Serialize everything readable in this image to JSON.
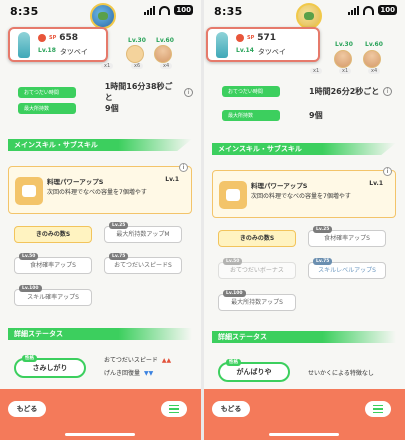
{
  "left": {
    "status": {
      "time": "8:35",
      "battery": "100"
    },
    "pokemon_card": {
      "sp_label": "SP",
      "sp_value": "658",
      "level_label": "Lv.18",
      "name": "タツベイ"
    },
    "items": [
      {
        "level_label": "Lv.30",
        "count": "x6"
      },
      {
        "level_label": "Lv.60",
        "count": "x4"
      },
      {
        "count": "x1"
      }
    ],
    "info": [
      {
        "label": "おてつだい時間",
        "value": "1時間16分38秒ごと"
      },
      {
        "label": "最大所持数",
        "value": "9個"
      }
    ],
    "section_skills": "メインスキル・サブスキル",
    "main_skill": {
      "name": "料理パワーアップS",
      "level": "Lv.1",
      "desc": "次回の料理でなべの容量を7個増やす"
    },
    "sub_skills": [
      {
        "tag": "",
        "label": "きのみの数S",
        "style": "gold"
      },
      {
        "tag": "Lv.25",
        "label": "最大所持数アップM",
        "style": "plain"
      },
      {
        "tag": "Lv.50",
        "label": "食材確率アップS",
        "style": "plain"
      },
      {
        "tag": "Lv.75",
        "label": "おてつだいスピードS",
        "style": "plain"
      },
      {
        "tag": "Lv.100",
        "label": "スキル確率アップS",
        "style": "plain"
      }
    ],
    "section_status": "詳細ステータス",
    "nature": {
      "tag": "性格",
      "name": "さみしがり"
    },
    "effects": [
      {
        "label": "おてつだいスピード",
        "mark": "▲▲",
        "dir": "up"
      },
      {
        "label": "げんき回復量",
        "mark": "▼▼",
        "dir": "down"
      }
    ],
    "back_label": "もどる"
  },
  "right": {
    "status": {
      "time": "8:35",
      "battery": "100"
    },
    "pokemon_card": {
      "sp_label": "SP",
      "sp_value": "571",
      "level_label": "Lv.14",
      "name": "タツベイ"
    },
    "items": [
      {
        "level_label": "Lv.30",
        "count": "x1"
      },
      {
        "level_label": "Lv.60",
        "count": "x4"
      },
      {
        "count": "x1"
      }
    ],
    "info": [
      {
        "label": "おてつだい時間",
        "value": "1時間26分2秒ごと"
      },
      {
        "label": "最大所持数",
        "value": "9個"
      }
    ],
    "section_skills": "メインスキル・サブスキル",
    "main_skill": {
      "name": "料理パワーアップS",
      "level": "Lv.1",
      "desc": "次回の料理でなべの容量を7個増やす"
    },
    "sub_skills": [
      {
        "tag": "",
        "label": "きのみの数S",
        "style": "gold"
      },
      {
        "tag": "Lv.25",
        "label": "食材確率アップS",
        "style": "plain"
      },
      {
        "tag": "Lv.50",
        "label": "おてつだいボーナス",
        "style": "faded"
      },
      {
        "tag": "Lv.75",
        "label": "スキルレベルアップS",
        "style": "blue"
      },
      {
        "tag": "Lv.100",
        "label": "最大所持数アップS",
        "style": "plain"
      }
    ],
    "section_status": "詳細ステータス",
    "nature": {
      "tag": "性格",
      "name": "がんばりや"
    },
    "effects": [
      {
        "label": "せいかくによる特徴なし",
        "mark": "",
        "dir": ""
      }
    ],
    "back_label": "もどる"
  }
}
